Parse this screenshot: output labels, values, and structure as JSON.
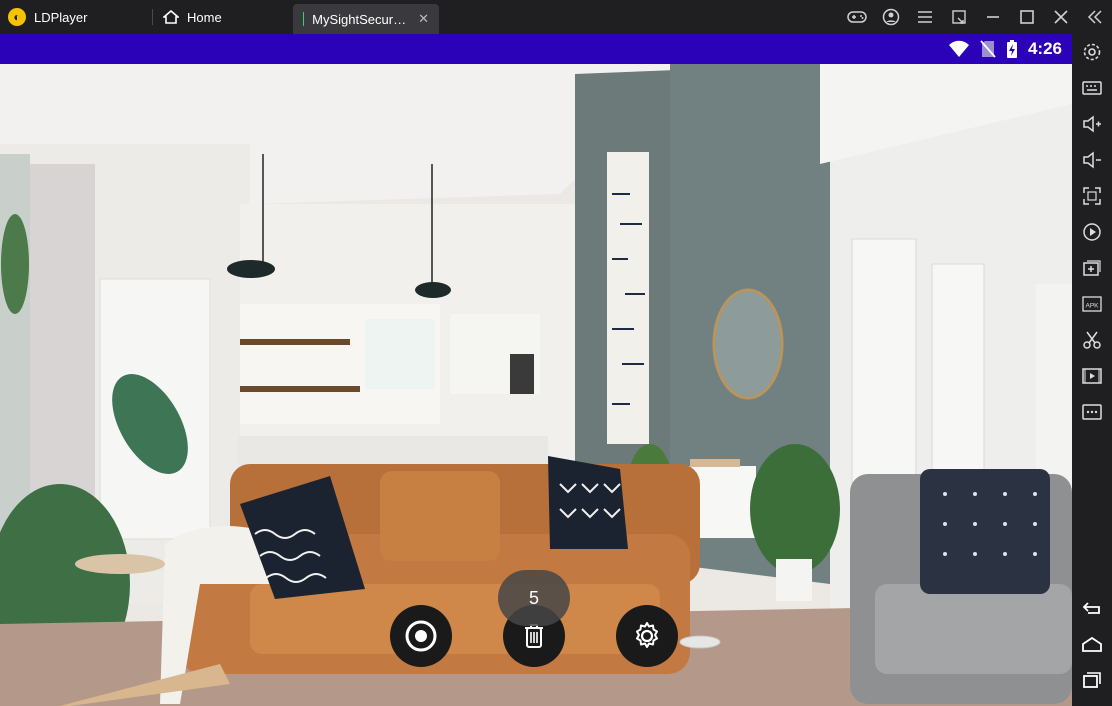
{
  "titlebar": {
    "app_name": "LDPlayer",
    "tabs": [
      {
        "label": "Home"
      },
      {
        "label": "MySightSecur…"
      }
    ],
    "controls": [
      "gamepad-icon",
      "account-icon",
      "menu-icon",
      "resize-icon",
      "minimize-icon",
      "maximize-icon",
      "close-icon"
    ]
  },
  "android_status": {
    "time": "4:26",
    "icons": [
      "wifi-icon",
      "no-sim-icon",
      "battery-charging-icon"
    ]
  },
  "camera_view": {
    "snapshot_count": "5"
  },
  "controls": {
    "buttons": [
      "record-button",
      "delete-button",
      "settings-button"
    ]
  },
  "side_toolbar": {
    "items": [
      "settings",
      "keyboard",
      "volume-up",
      "volume-down",
      "fullscreen",
      "operation-record",
      "add-app",
      "apk-install",
      "screenshot-cut",
      "video",
      "more",
      "back",
      "home",
      "recents"
    ]
  },
  "colors": {
    "titlebar": "#1f1f22",
    "statusbar": "#2c02b8",
    "fab": "#1a1a1a"
  }
}
